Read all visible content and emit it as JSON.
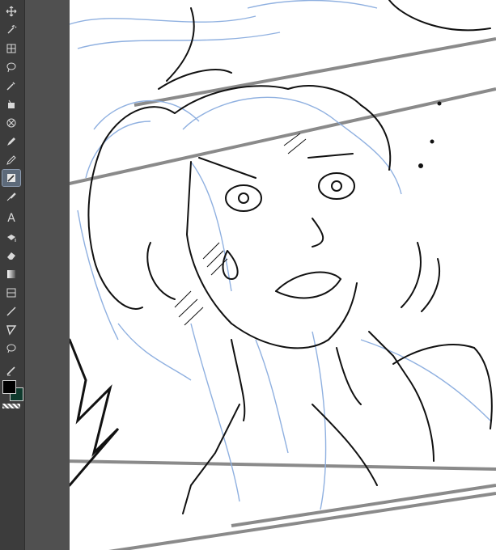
{
  "colors": {
    "rail": "#3c3c3c",
    "strip": "#505050",
    "foreground": "#000000",
    "background": "#0f3a2d",
    "sketch_blue": "#8fb0e0",
    "ink": "#111111",
    "frame_gray": "#8a8a8a"
  },
  "toolbar": {
    "tools": [
      {
        "name": "move-tool",
        "icon": "move-icon"
      },
      {
        "name": "auto-select-tool",
        "icon": "magic-wand-icon"
      },
      {
        "name": "zoom-tool",
        "icon": "zoom-icon"
      },
      {
        "name": "lasso-tool",
        "icon": "lasso-icon"
      },
      {
        "name": "eyedropper-tool",
        "icon": "eyedropper-icon"
      },
      {
        "name": "fill-bucket-tool",
        "icon": "bucket-icon"
      },
      {
        "name": "blend-tool",
        "icon": "blend-icon"
      },
      {
        "name": "pen-tool",
        "icon": "pen-icon"
      },
      {
        "name": "pencil-tool",
        "icon": "pencil-icon"
      },
      {
        "name": "brush-tool",
        "icon": "brush-icon",
        "active": true
      },
      {
        "name": "airbrush-tool",
        "icon": "airbrush-icon"
      },
      {
        "name": "text-tool",
        "icon": "text-icon",
        "label": "A"
      },
      {
        "name": "decoration-tool",
        "icon": "decoration-icon"
      },
      {
        "name": "eraser-tool",
        "icon": "eraser-icon"
      },
      {
        "name": "gradient-tool",
        "icon": "gradient-icon"
      },
      {
        "name": "frame-tool",
        "icon": "frame-icon"
      },
      {
        "name": "line-tool",
        "icon": "line-icon"
      },
      {
        "name": "ruler-tool",
        "icon": "ruler-icon"
      },
      {
        "name": "balloon-tool",
        "icon": "balloon-icon"
      },
      {
        "name": "correct-line-tool",
        "icon": "correct-line-icon"
      }
    ]
  }
}
